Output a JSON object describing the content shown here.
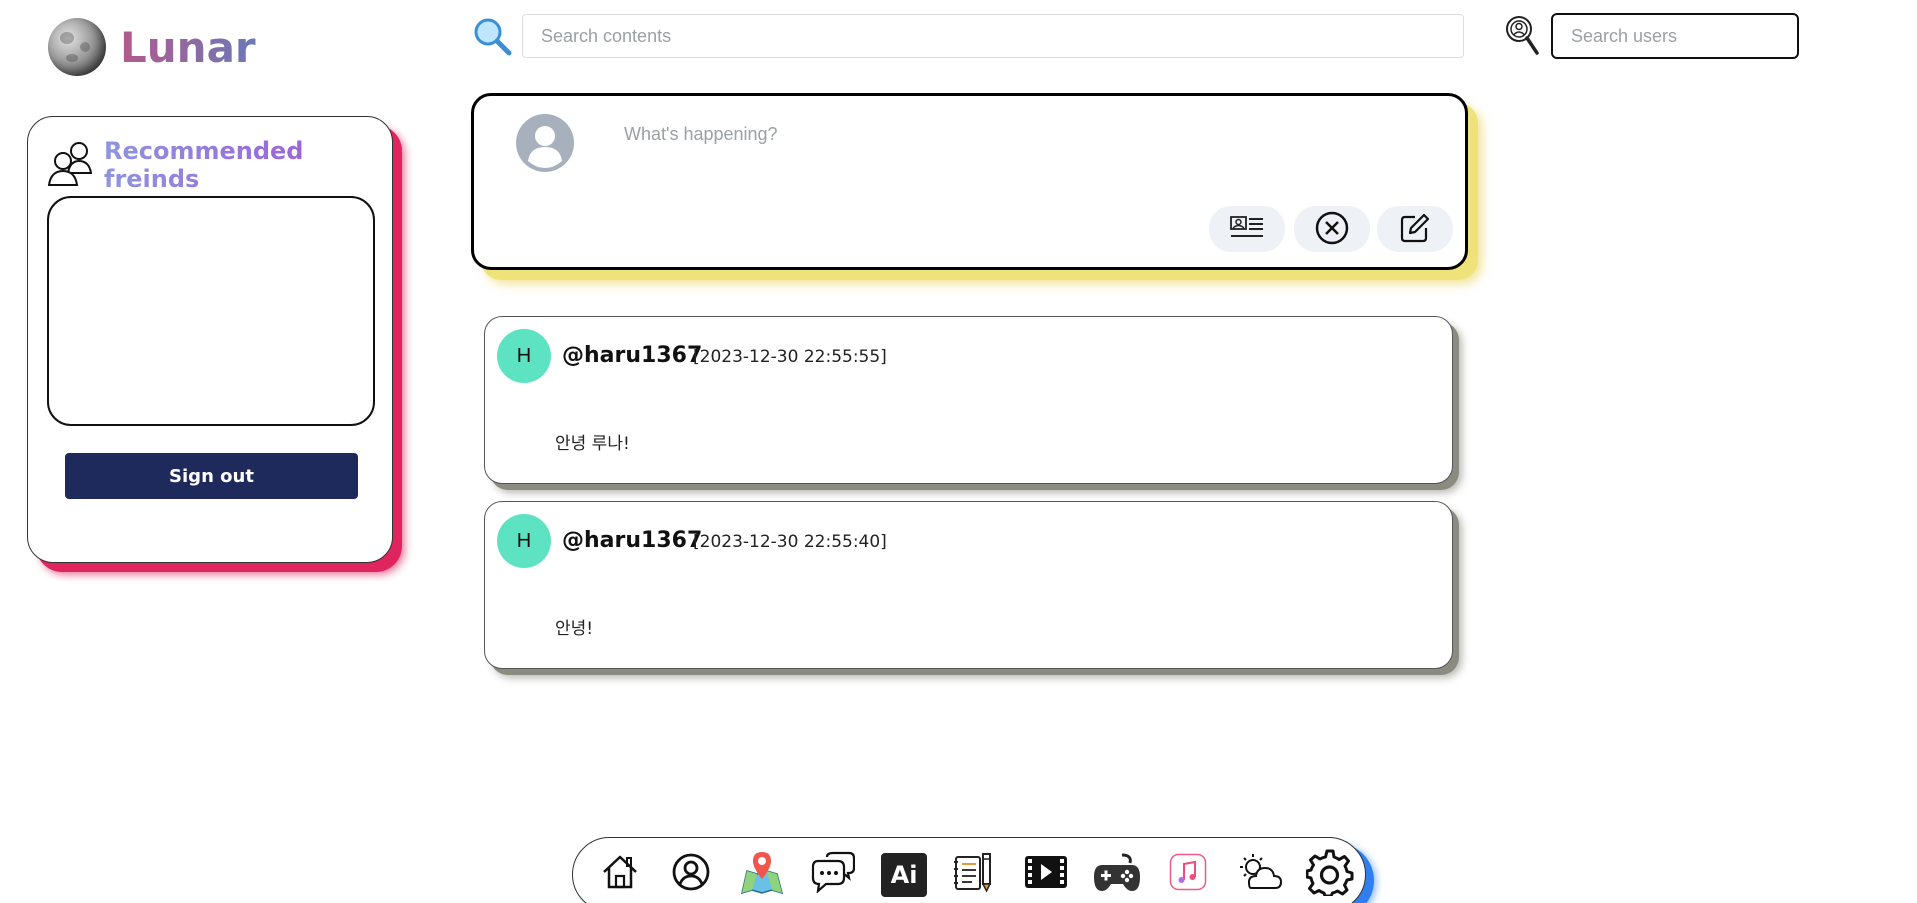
{
  "app": {
    "name": "Lunar"
  },
  "header": {
    "content_search_placeholder": "Search contents",
    "user_search_placeholder": "Search users"
  },
  "sidebar": {
    "title": "Recommended freinds",
    "signout_label": "Sign out"
  },
  "composer": {
    "placeholder": "What's happening?"
  },
  "posts": [
    {
      "avatar_letter": "H",
      "username": "@haru1367",
      "timestamp": "[2023-12-30 22:55:55]",
      "text": "안녕 루나!"
    },
    {
      "avatar_letter": "H",
      "username": "@haru1367",
      "timestamp": "[2023-12-30 22:55:40]",
      "text": "안녕!"
    }
  ],
  "bottom_nav": {
    "items": [
      "home-icon",
      "profile-icon",
      "map-icon",
      "chat-icon",
      "ai-icon",
      "notebook-icon",
      "video-icon",
      "game-icon",
      "music-icon",
      "weather-icon",
      "settings-icon"
    ],
    "ai_label": "Ai"
  },
  "colors": {
    "signout_bg": "#1f2a5c",
    "post_avatar": "#5de3c2",
    "sidebar_shadow": "#e0245e",
    "composer_shadow": "#efe27a",
    "nav_shadow": "#2f7ff0"
  }
}
